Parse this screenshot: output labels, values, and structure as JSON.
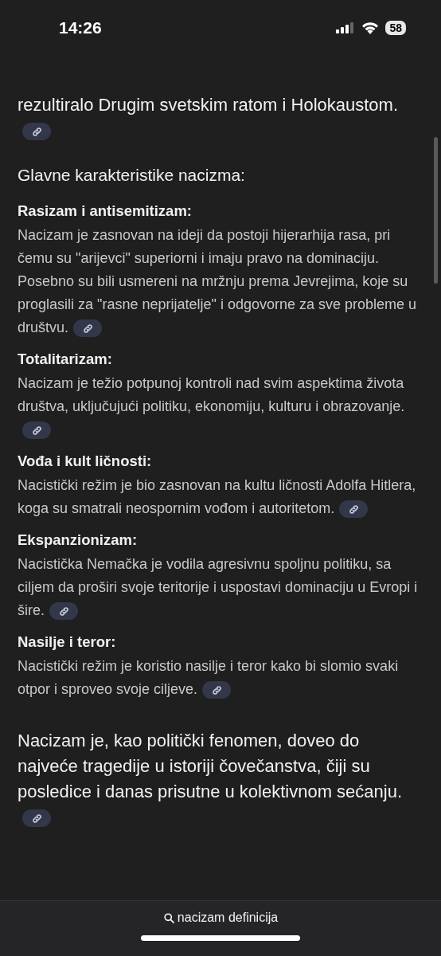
{
  "status_bar": {
    "time": "14:26",
    "battery": "58"
  },
  "intro": "rezultiralo Drugim svetskim ratom i Holokaustom.",
  "heading": "Glavne karakteristike nacizma:",
  "sections": [
    {
      "title": "Rasizam i antisemitizam:",
      "body": "Nacizam je zasnovan na ideji da postoji hijerarhija rasa, pri čemu su \"arijevci\" superiorni i imaju pravo na dominaciju. Posebno su bili usmereni na mržnju prema Jevrejima, koje su proglasili za \"rasne neprijatelje\" i odgovorne za sve probleme u društvu."
    },
    {
      "title": "Totalitarizam:",
      "body": "Nacizam je težio potpunoj kontroli nad svim aspektima života društva, uključujući politiku, ekonomiju, kulturu i obrazovanje."
    },
    {
      "title": "Vođa i kult ličnosti:",
      "body": "Nacistički režim je bio zasnovan na kultu ličnosti Adolfa Hitlera, koga su smatrali neospornim vođom i autoritetom."
    },
    {
      "title": "Ekspanzionizam:",
      "body": "Nacistička Nemačka je vodila agresivnu spoljnu politiku, sa ciljem da proširi svoje teritorije i uspostavi dominaciju u Evropi i šire."
    },
    {
      "title": "Nasilje i teror:",
      "body": "Nacistički režim je koristio nasilje i teror kako bi slomio svaki otpor i sproveo svoje ciljeve."
    }
  ],
  "conclusion": "Nacizam je, kao politički fenomen, doveo do najveće tragedije u istoriji čovečanstva, čiji su posledice i danas prisutne u kolektivnom sećanju.",
  "search_bar": {
    "query": "nacizam definicija"
  }
}
